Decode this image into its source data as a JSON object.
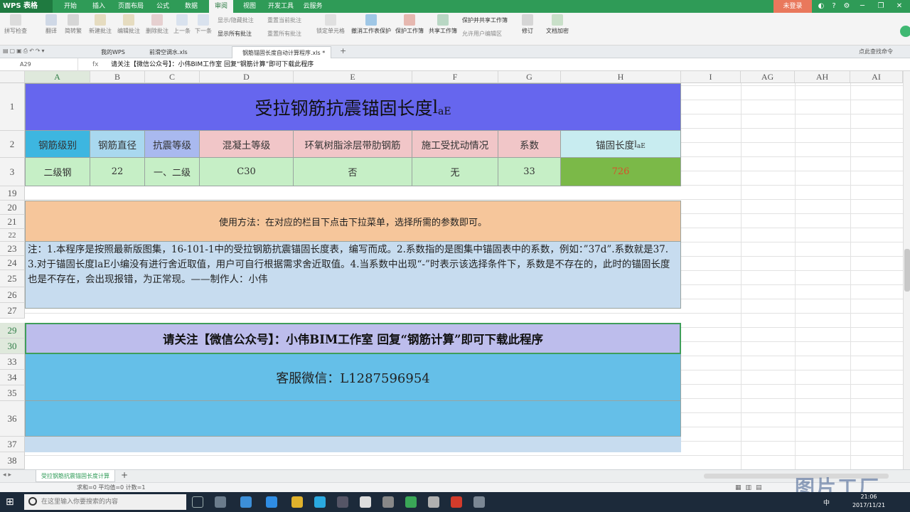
{
  "menubar": {
    "app": "WPS 表格",
    "tabs": [
      "开始",
      "插入",
      "页面布局",
      "公式",
      "数据",
      "审阅",
      "视图",
      "开发工具",
      "云服务"
    ],
    "active_tab": "审阅",
    "login": "未登录"
  },
  "ribbon": {
    "buttons": [
      "拼写检查",
      "翻译",
      "简转繁",
      "新建批注",
      "编辑批注",
      "删除批注",
      "上一条",
      "下一条"
    ],
    "small": [
      "显示/隐藏批注",
      "重置当前批注",
      "显示所有批注",
      "重置所有批注"
    ],
    "buttons2": [
      "锁定单元格",
      "撤消工作表保护",
      "保护工作簿",
      "共享工作簿",
      "修订",
      "文档加密"
    ],
    "small2": [
      "保护并共享工作簿",
      "允许用户编辑区"
    ]
  },
  "doctabs": {
    "tabs": [
      "我的WPS",
      "前滑空调水.xls",
      "钢筋锚固长度自动计算程序.xls *"
    ],
    "right_hint": "点此查找命令"
  },
  "formula_bar": {
    "name": "A29",
    "fx": "fx",
    "content": "请关注【微信公众号】：小伟BIM工作室  回复“钢筋计算”即可下载此程序"
  },
  "columns": [
    "A",
    "B",
    "C",
    "D",
    "E",
    "F",
    "G",
    "H",
    "I",
    "AG",
    "AH",
    "AI"
  ],
  "rows": [
    "1",
    "2",
    "3",
    "19",
    "20",
    "21",
    "22",
    "23",
    "24",
    "25",
    "26",
    "27",
    "29",
    "30",
    "33",
    "34",
    "35",
    "36",
    "37",
    "38"
  ],
  "sheet": {
    "title": "受拉钢筋抗震锚固长度",
    "title_sym": "l",
    "title_sub": "aE",
    "headers": [
      "钢筋级别",
      "钢筋直径",
      "抗震等级",
      "混凝土等级",
      "环氧树脂涂层带肋钢筋",
      "施工受扰动情况",
      "系数",
      "锚固长度"
    ],
    "h_sym": "l",
    "h_sub": "aE",
    "values": [
      "二级钢",
      "22",
      "一、二级",
      "C30",
      "否",
      "无",
      "33",
      "726"
    ],
    "usage": "使用方法：在对应的栏目下点击下拉菜单，选择所需的参数即可。",
    "note": "注：1.本程序是按照最新版图集，16-101-1中的受拉钢筋抗震锚固长度表，编写而成。2.系数指的是图集中锚固表中的系数，例如：”37d”.系数就是37.  3.对于锚固长度laE小编没有进行舍近取值，用户可自行根据需求舍近取值。4.当系数中出现“-”时表示该选择条件下，系数是不存在的，此时的锚固长度也是不存在，会出现报错，为正常现。——制作人：小伟",
    "follow": "请关注【微信公众号】：小伟BIM工作室  回复“钢筋计算”即可下载此程序",
    "service": "客服微信：L1287596954"
  },
  "sheet_tab": "受拉钢筋抗震锚固长度计算",
  "status": "求和=0  平均值=0  计数=1",
  "taskbar": {
    "search": "在这里输入你要搜索的内容",
    "time": "21:06",
    "date": "2017/11/21",
    "ime": "中"
  },
  "watermark": "图片工厂",
  "colors": {
    "title_bg": "#6666ee",
    "hdr_blue": "#3db6e0",
    "hdr_lightblue": "#a9d8ef",
    "hdr_periwinkle": "#a9b9ef",
    "hdr_pink": "#f1c6c8",
    "hdr_cyan": "#c8ecf0",
    "row_green": "#c6efc6",
    "result_green": "#7bb948",
    "result_text": "#d8502b",
    "usage_bg": "#f6c69b",
    "note_bg": "#c7dcef",
    "follow_bg": "#bdbdec",
    "service_bg": "#65bfe8"
  }
}
